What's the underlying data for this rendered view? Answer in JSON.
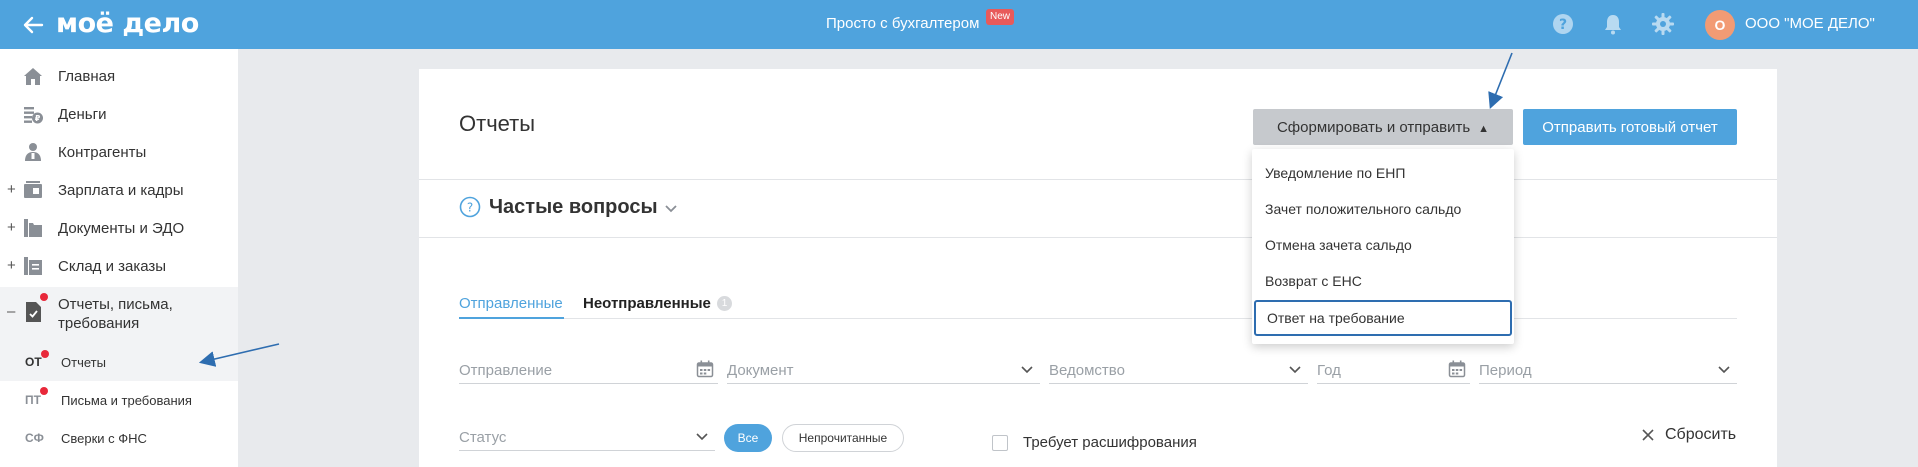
{
  "topbar": {
    "logo": "моё дело",
    "promo": "Просто с бухгалтером",
    "promo_badge": "New",
    "avatar_letter": "О",
    "company": "ООО \"МОЕ ДЕЛО\"",
    "color": "#4fa3dd"
  },
  "sidebar": {
    "items": [
      {
        "label": "Главная",
        "icon": "home-icon"
      },
      {
        "label": "Деньги",
        "icon": "money-icon"
      },
      {
        "label": "Контрагенты",
        "icon": "contractors-icon"
      },
      {
        "label": "Зарплата и кадры",
        "icon": "salary-icon",
        "expand": "+"
      },
      {
        "label": "Документы и ЭДО",
        "icon": "folder-icon",
        "expand": "+"
      },
      {
        "label": "Склад и заказы",
        "icon": "warehouse-icon",
        "expand": "+"
      },
      {
        "label_line1": "Отчеты, письма,",
        "label_line2": "требования",
        "icon": "report-check-icon",
        "expand": "–"
      }
    ],
    "subitems": [
      {
        "abbr": "ОТ",
        "label": "Отчеты"
      },
      {
        "abbr": "ПТ",
        "label": "Письма и требования"
      },
      {
        "abbr": "СФ",
        "label": "Сверки с ФНС"
      }
    ]
  },
  "main": {
    "title": "Отчеты",
    "btn_form": "Сформировать и отправить",
    "btn_send": "Отправить готовый отчет",
    "faq": "Частые вопросы",
    "tabs": [
      {
        "label": "Отправленные",
        "active": true
      },
      {
        "label": "Неотправленные",
        "count": "1"
      }
    ],
    "filters": {
      "sending": "Отправление",
      "document": "Документ",
      "agency": "Ведомство",
      "year": "Год",
      "period": "Период",
      "status": "Статус",
      "chip_all": "Все",
      "chip_unread": "Непрочитанные",
      "needs_decrypt": "Требует расшифрования",
      "reset": "Сбросить"
    }
  },
  "dropdown": {
    "items": [
      "Уведомление по ЕНП",
      "Зачет положительного сальдо",
      "Отмена зачета сальдо",
      "Возврат с ЕНС",
      "Ответ на требование"
    ]
  }
}
